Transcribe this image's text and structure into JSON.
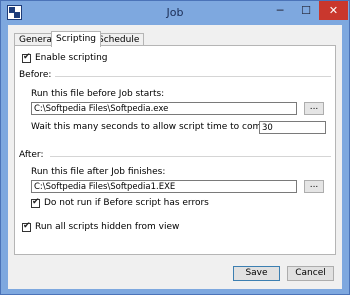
{
  "window": {
    "title": "Job",
    "minimize_glyph": "─",
    "maximize_glyph": "☐",
    "close_glyph": "✕"
  },
  "tabs": [
    {
      "label": "General"
    },
    {
      "label": "Scripting",
      "selected": true
    },
    {
      "label": "Schedule"
    }
  ],
  "enable_scripting": {
    "label": "Enable scripting",
    "checked": true
  },
  "before": {
    "heading": "Before:",
    "run_label": "Run this file before Job starts:",
    "run_value": "C:\\Softpedia Files\\Softpedia.exe",
    "browse_label": "...",
    "wait_label": "Wait this many seconds to allow script time to complete:",
    "wait_value": "30"
  },
  "after": {
    "heading": "After:",
    "run_label": "Run this file after Job finishes:",
    "run_value": "C:\\Softpedia Files\\Softpedia1.EXE",
    "browse_label": "...",
    "skip_on_error": {
      "label": "Do not run if Before script has errors",
      "checked": true
    }
  },
  "run_hidden": {
    "label": "Run all scripts hidden from view",
    "checked": true
  },
  "buttons": {
    "save": "Save",
    "cancel": "Cancel"
  }
}
